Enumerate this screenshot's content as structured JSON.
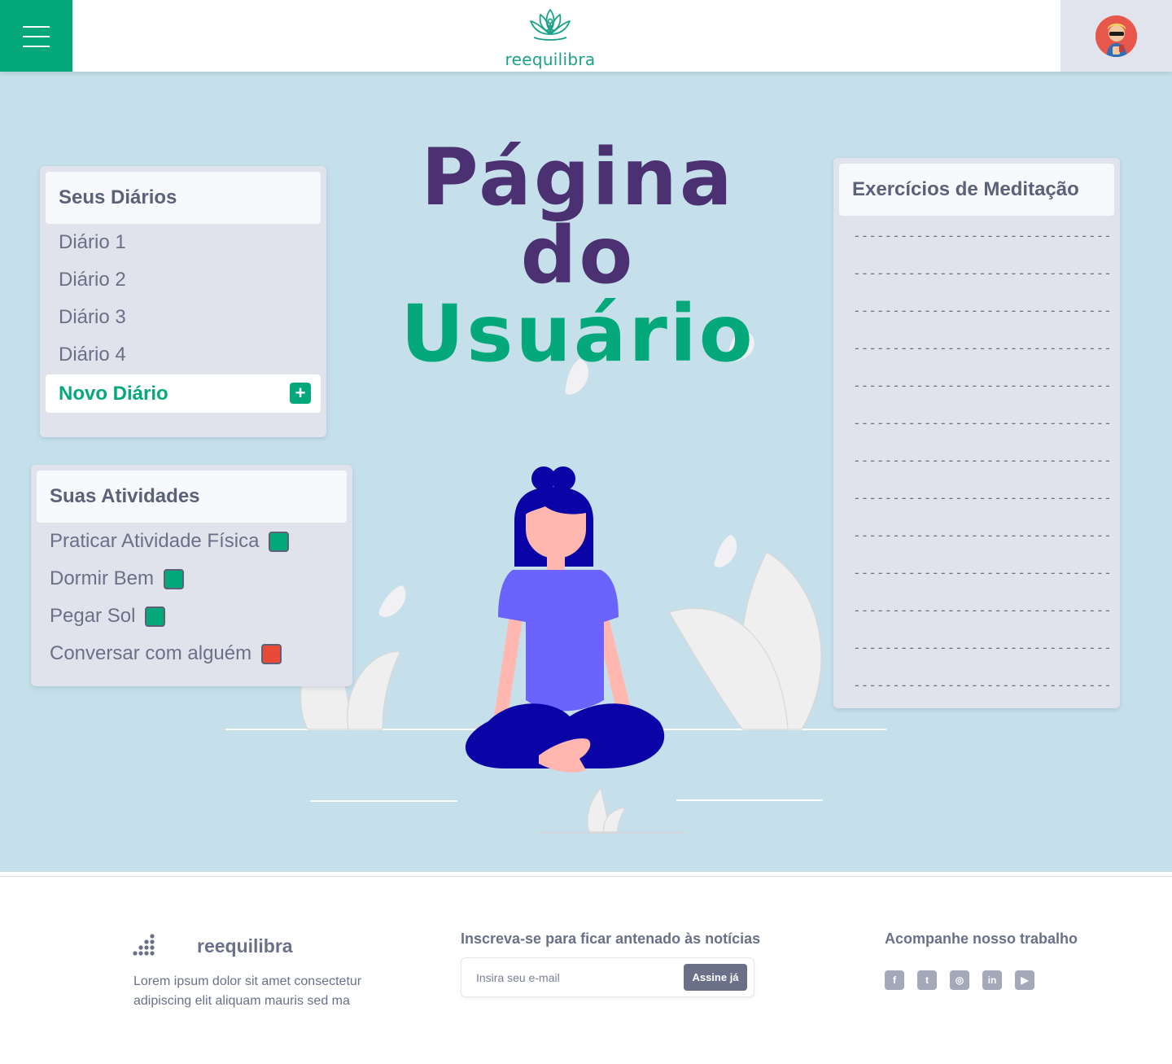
{
  "header": {
    "logo_text": "reequilibra"
  },
  "hero": {
    "title_line1": "Página do",
    "title_line2": "Usuário"
  },
  "diaries": {
    "title": "Seus Diários",
    "items": [
      "Diário 1",
      "Diário 2",
      "Diário 3",
      "Diário 4"
    ],
    "new_label": "Novo Diário",
    "new_icon": "+"
  },
  "activities": {
    "title": "Suas Atividades",
    "items": [
      {
        "label": "Praticar Atividade Física",
        "status": "green"
      },
      {
        "label": "Dormir Bem",
        "status": "green"
      },
      {
        "label": "Pegar Sol",
        "status": "green"
      },
      {
        "label": "Conversar com alguém",
        "status": "red"
      }
    ]
  },
  "meditation": {
    "title": "Exercícios de Meditação",
    "lines": [
      "---------------------------------",
      "---------------------------------",
      "---------------------------------",
      "---------------------------------",
      "---------------------------------",
      "---------------------------------",
      "---------------------------------",
      "---------------------------------",
      "---------------------------------",
      "---------------------------------",
      "---------------------------------",
      "---------------------------------",
      "---------------------------------"
    ]
  },
  "footer": {
    "brand": "reequilibra",
    "description": "Lorem ipsum dolor sit amet consectetur adipiscing elit aliquam mauris sed ma",
    "subscribe_title": "Inscreva-se para ficar antenado às notícias",
    "email_placeholder": "Insira seu e-mail",
    "subscribe_button": "Assine já",
    "follow_title": "Acompanhe nosso trabalho",
    "socials": [
      {
        "name": "facebook-icon",
        "glyph": "f"
      },
      {
        "name": "twitter-icon",
        "glyph": "t"
      },
      {
        "name": "instagram-icon",
        "glyph": "◎"
      },
      {
        "name": "linkedin-icon",
        "glyph": "in"
      },
      {
        "name": "youtube-icon",
        "glyph": "▶"
      }
    ]
  },
  "colors": {
    "brand_green": "#05a87a",
    "title_purple": "#4b3172",
    "background_blue": "#c5e0eb",
    "card_gray": "#e1e3ec",
    "check_green": "#05a87a",
    "check_red": "#e84a37"
  }
}
